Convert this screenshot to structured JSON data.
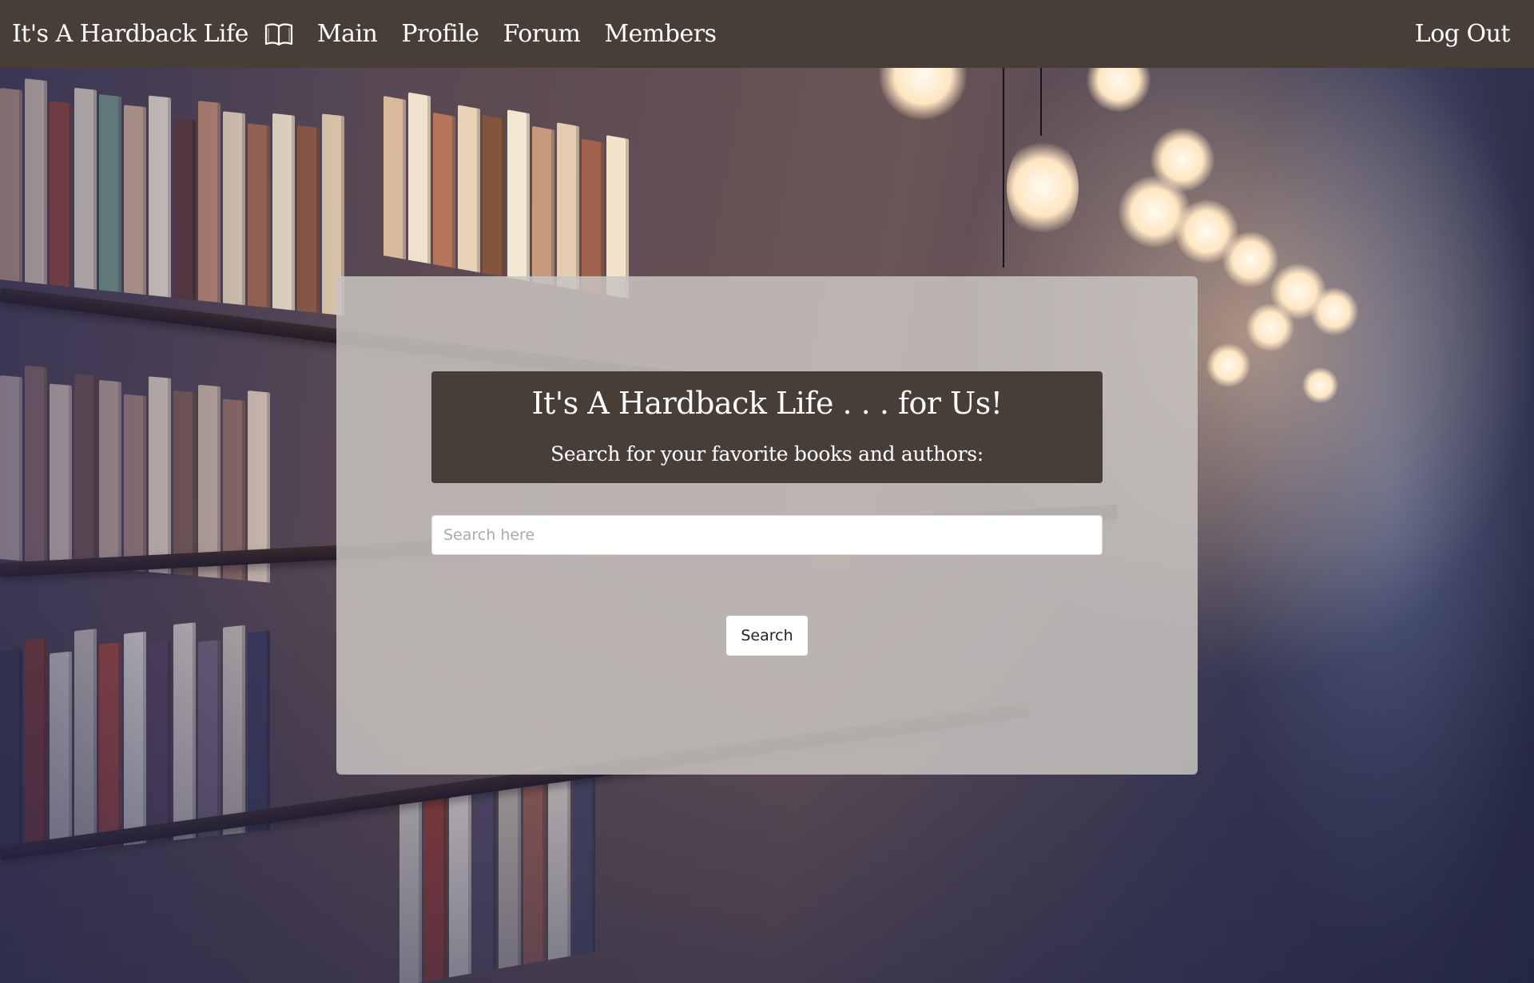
{
  "navbar": {
    "brand": "It's A Hardback Life",
    "brand_icon": "open-book-icon",
    "links": [
      {
        "label": "Main"
      },
      {
        "label": "Profile"
      },
      {
        "label": "Forum"
      },
      {
        "label": "Members"
      }
    ],
    "logout_label": "Log Out"
  },
  "hero": {
    "title": "It's A Hardback Life . . . for Us!",
    "subtitle": "Search for your favorite books and authors:"
  },
  "search": {
    "placeholder": "Search here",
    "value": "",
    "button_label": "Search"
  },
  "colors": {
    "navbar_bg": "#483e38",
    "hero_bg": "#483e38",
    "panel_bg": "rgba(200,196,192,0.86)",
    "text_light": "#ffffff"
  }
}
